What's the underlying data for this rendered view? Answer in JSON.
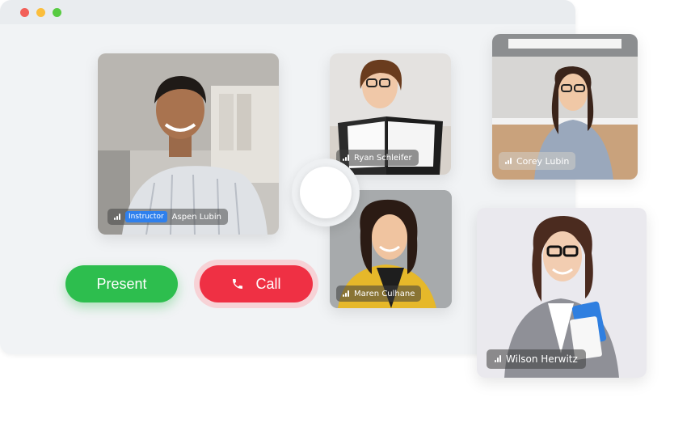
{
  "window": {
    "controls": [
      "close-dot",
      "minimize-dot",
      "maximize-dot"
    ]
  },
  "participants": {
    "aspen": {
      "name": "Aspen Lubin",
      "role": "Instructor"
    },
    "ryan": {
      "name": "Ryan Schleifer"
    },
    "maren": {
      "name": "Maren Culhane"
    },
    "corey": {
      "name": "Corey Lubin"
    },
    "wilson": {
      "name": "Wilson Herwitz"
    }
  },
  "actions": {
    "present_label": "Present",
    "call_label": "Call"
  },
  "colors": {
    "present": "#2dbe4e",
    "call": "#ef3044",
    "instructor_badge": "#2f80ed",
    "window_bg": "#f1f3f5"
  },
  "icons": [
    "signal-bars-icon",
    "phone-icon"
  ]
}
